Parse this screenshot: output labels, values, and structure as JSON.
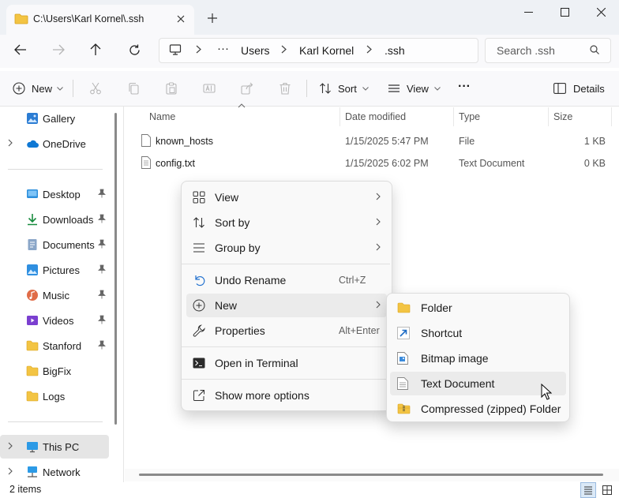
{
  "window": {
    "tab_title": "C:\\Users\\Karl Kornel\\.ssh"
  },
  "address": {
    "crumbs": [
      "Users",
      "Karl Kornel",
      ".ssh"
    ],
    "overflow": "···"
  },
  "search": {
    "placeholder": "Search .ssh"
  },
  "toolbar": {
    "new_label": "New",
    "sort_label": "Sort",
    "view_label": "View",
    "more_label": "···",
    "details_label": "Details"
  },
  "sidebar": {
    "items": [
      {
        "label": "Gallery",
        "icon": "gallery-icon"
      },
      {
        "label": "OneDrive",
        "icon": "cloud-icon"
      },
      {
        "label": "Desktop",
        "icon": "desktop-icon"
      },
      {
        "label": "Downloads",
        "icon": "download-icon"
      },
      {
        "label": "Documents",
        "icon": "documents-icon"
      },
      {
        "label": "Pictures",
        "icon": "pictures-icon"
      },
      {
        "label": "Music",
        "icon": "music-icon"
      },
      {
        "label": "Videos",
        "icon": "videos-icon"
      },
      {
        "label": "Stanford",
        "icon": "folder-icon"
      },
      {
        "label": "BigFix",
        "icon": "folder-icon"
      },
      {
        "label": "Logs",
        "icon": "folder-icon"
      },
      {
        "label": "This PC",
        "icon": "pc-icon"
      },
      {
        "label": "Network",
        "icon": "network-icon"
      }
    ]
  },
  "columns": [
    "Name",
    "Date modified",
    "Type",
    "Size"
  ],
  "files": [
    {
      "name": "known_hosts",
      "date": "1/15/2025 5:47 PM",
      "type": "File",
      "size": "1 KB"
    },
    {
      "name": "config.txt",
      "date": "1/15/2025 6:02 PM",
      "type": "Text Document",
      "size": "0 KB"
    }
  ],
  "context_menu": {
    "view": "View",
    "sort_by": "Sort by",
    "group_by": "Group by",
    "undo_rename": "Undo Rename",
    "undo_shortcut": "Ctrl+Z",
    "new": "New",
    "properties": "Properties",
    "properties_shortcut": "Alt+Enter",
    "open_terminal": "Open in Terminal",
    "show_more": "Show more options"
  },
  "submenu": {
    "folder": "Folder",
    "shortcut": "Shortcut",
    "bitmap": "Bitmap image",
    "text_document": "Text Document",
    "compressed": "Compressed (zipped) Folder"
  },
  "status": {
    "count": "2 items"
  },
  "colors": {
    "accent": "#0067c0",
    "folder": "#f3c443",
    "selected": "#e5e5e5"
  }
}
